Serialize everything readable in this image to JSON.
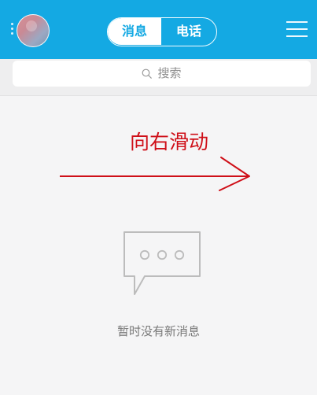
{
  "header": {
    "tabs": [
      {
        "label": "消息",
        "selected": true
      },
      {
        "label": "电话",
        "selected": false
      }
    ],
    "icons": {
      "avatar": "profile-avatar",
      "menu": "menu-icon"
    },
    "colors": {
      "bar": "#14a9e3",
      "selected_text": "#14a9e3",
      "unselected_text": "#ffffff"
    }
  },
  "search": {
    "placeholder": "搜索",
    "icon": "search-icon"
  },
  "annotation": {
    "text": "向右滑动",
    "color": "#cf0f18"
  },
  "empty_state": {
    "message": "暂时没有新消息",
    "icon": "chat-bubble-icon"
  }
}
